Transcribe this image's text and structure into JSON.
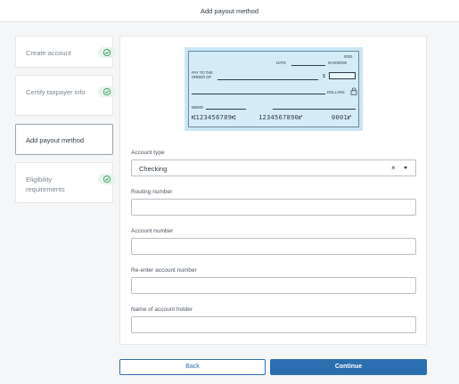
{
  "header": {
    "title": "Add payout method"
  },
  "steps": [
    {
      "label": "Create account",
      "completed": true
    },
    {
      "label": "Certify taxpayer info",
      "completed": true
    },
    {
      "label": "Add payout method",
      "completed": false,
      "active": true
    },
    {
      "label": "Eligibility requirements",
      "completed": true
    }
  ],
  "cheque": {
    "number": "0000",
    "date_label": "DATE",
    "date_format": "00-000/000",
    "pay_to_label_1": "PAY TO THE",
    "pay_to_label_2": "ORDER OF",
    "dollar_sign": "$",
    "dollars_label": "DOLLARS",
    "memo_label": "MEMO",
    "routing_digits": "⑆123456789⑆",
    "account_digits": "1234567890⑈",
    "check_digits": "0001⑈"
  },
  "form": {
    "account_type": {
      "label": "Account type",
      "value": "Checking",
      "clear_icon": "×"
    },
    "routing_number": {
      "label": "Routing number",
      "value": ""
    },
    "account_number": {
      "label": "Account number",
      "value": ""
    },
    "reenter_account_number": {
      "label": "Re-enter account number",
      "value": ""
    },
    "account_holder": {
      "label": "Name of account holder",
      "value": ""
    }
  },
  "buttons": {
    "back": "Back",
    "continue": "Continue"
  },
  "colors": {
    "primary": "#2a6fb0",
    "success": "#2e9e5b",
    "cheque_bg": "#c9e7f5"
  }
}
